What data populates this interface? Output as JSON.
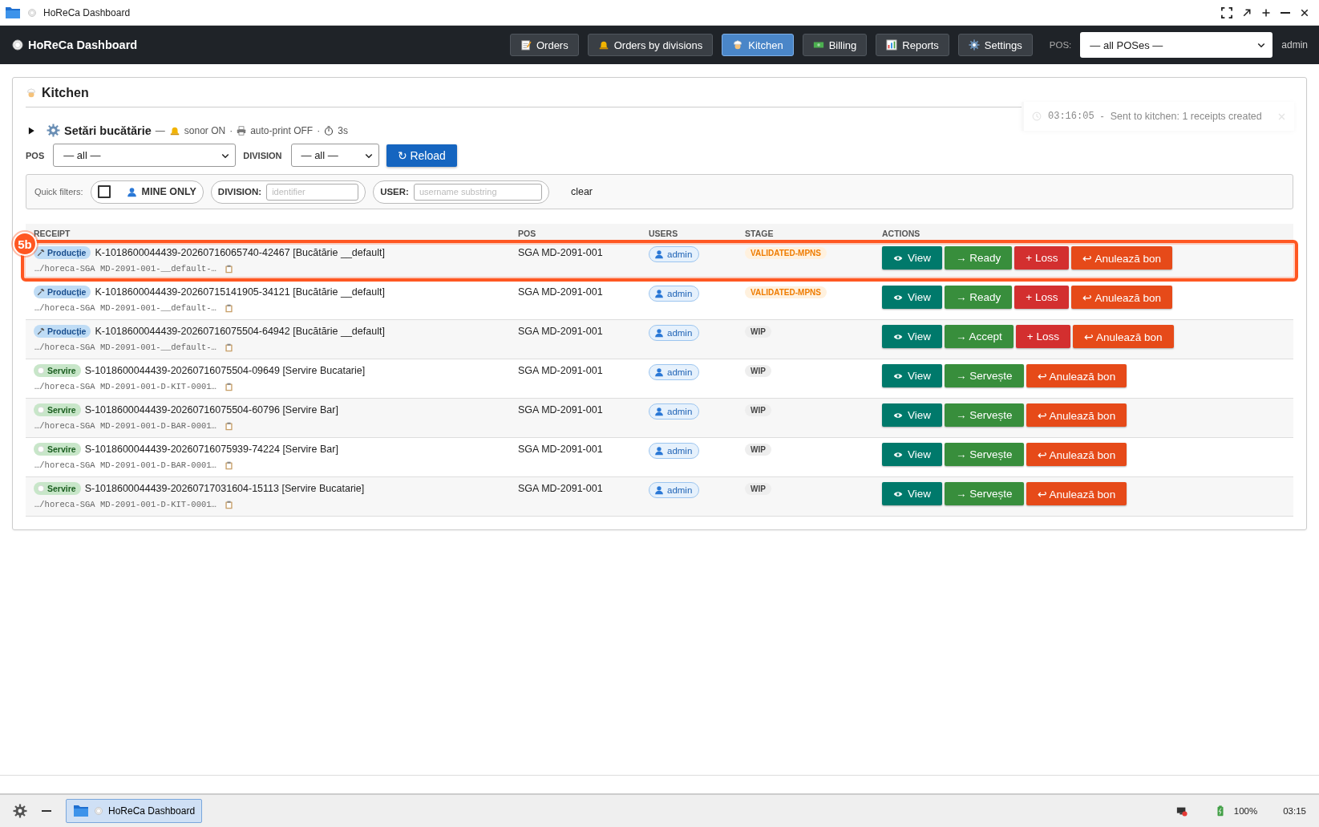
{
  "window": {
    "title": "HoReCa Dashboard"
  },
  "navbar": {
    "brand": "HoReCa Dashboard",
    "items": [
      {
        "label": "Orders",
        "selected": false
      },
      {
        "label": "Orders by divisions",
        "selected": false
      },
      {
        "label": "Kitchen",
        "selected": true
      },
      {
        "label": "Billing",
        "selected": false
      },
      {
        "label": "Reports",
        "selected": false
      },
      {
        "label": "Settings",
        "selected": false
      }
    ],
    "pos_label": "POS:",
    "pos_value": "— all POSes —",
    "user": "admin"
  },
  "page": {
    "title": "Kitchen"
  },
  "toast": {
    "time": "03:16:05",
    "separator": "-",
    "message": "Sent to kitchen: 1 receipts created"
  },
  "settings": {
    "title": "Setări bucătărie",
    "dash": "—",
    "items": [
      "sonor ON",
      "auto-print OFF",
      "3s"
    ],
    "separator": "·"
  },
  "filters": {
    "pos_label": "POS",
    "pos_value": "— all —",
    "division_label": "DIVISION",
    "division_value": "— all —",
    "reload": "↻ Reload"
  },
  "quick_filters": {
    "label": "Quick filters:",
    "mine_only": {
      "label": "MINE ONLY",
      "checked": false
    },
    "division": {
      "label": "DIVISION:",
      "placeholder": "identifier"
    },
    "user": {
      "label": "USER:",
      "placeholder": "username substring"
    },
    "clear": "clear"
  },
  "table": {
    "columns": [
      "RECEIPT",
      "POS",
      "USERS",
      "STAGE",
      "ACTIONS"
    ],
    "rows": [
      {
        "callout": "5b",
        "badge": {
          "kind": "production",
          "label": "Producție"
        },
        "receipt": "K-1018600044439-20260716065740-42467 [Bucătărie __default]",
        "path": "…/horeca-SGA MD-2091-001-__default-…",
        "pos": "SGA MD-2091-001",
        "user": "admin",
        "stage": {
          "kind": "validated",
          "label": "VALIDATED-MPNS"
        },
        "actions": [
          {
            "kind": "view",
            "label": "View"
          },
          {
            "kind": "advance",
            "label": "→ Ready"
          },
          {
            "kind": "loss",
            "label": "+ Loss"
          },
          {
            "kind": "cancel",
            "label": "↩ Anulează bon"
          }
        ]
      },
      {
        "badge": {
          "kind": "production",
          "label": "Producție"
        },
        "receipt": "K-1018600044439-20260715141905-34121 [Bucătărie __default]",
        "path": "…/horeca-SGA MD-2091-001-__default-…",
        "pos": "SGA MD-2091-001",
        "user": "admin",
        "stage": {
          "kind": "validated",
          "label": "VALIDATED-MPNS"
        },
        "actions": [
          {
            "kind": "view",
            "label": "View"
          },
          {
            "kind": "advance",
            "label": "→ Ready"
          },
          {
            "kind": "loss",
            "label": "+ Loss"
          },
          {
            "kind": "cancel",
            "label": "↩ Anulează bon"
          }
        ]
      },
      {
        "badge": {
          "kind": "production",
          "label": "Producție"
        },
        "receipt": "K-1018600044439-20260716075504-64942 [Bucătărie __default]",
        "path": "…/horeca-SGA MD-2091-001-__default-…",
        "pos": "SGA MD-2091-001",
        "user": "admin",
        "stage": {
          "kind": "wip",
          "label": "WIP"
        },
        "actions": [
          {
            "kind": "view",
            "label": "View"
          },
          {
            "kind": "advance",
            "label": "→ Accept"
          },
          {
            "kind": "loss",
            "label": "+ Loss"
          },
          {
            "kind": "cancel",
            "label": "↩ Anulează bon"
          }
        ]
      },
      {
        "badge": {
          "kind": "serving",
          "label": "Servire"
        },
        "receipt": "S-1018600044439-20260716075504-09649 [Servire Bucatarie]",
        "path": "…/horeca-SGA MD-2091-001-D-KIT-0001…",
        "pos": "SGA MD-2091-001",
        "user": "admin",
        "stage": {
          "kind": "wip",
          "label": "WIP"
        },
        "actions": [
          {
            "kind": "view",
            "label": "View"
          },
          {
            "kind": "advance",
            "label": "→ Servește"
          },
          {
            "kind": "cancel",
            "label": "↩ Anulează bon"
          }
        ]
      },
      {
        "badge": {
          "kind": "serving",
          "label": "Servire"
        },
        "receipt": "S-1018600044439-20260716075504-60796 [Servire Bar]",
        "path": "…/horeca-SGA MD-2091-001-D-BAR-0001…",
        "pos": "SGA MD-2091-001",
        "user": "admin",
        "stage": {
          "kind": "wip",
          "label": "WIP"
        },
        "actions": [
          {
            "kind": "view",
            "label": "View"
          },
          {
            "kind": "advance",
            "label": "→ Servește"
          },
          {
            "kind": "cancel",
            "label": "↩ Anulează bon"
          }
        ]
      },
      {
        "badge": {
          "kind": "serving",
          "label": "Servire"
        },
        "receipt": "S-1018600044439-20260716075939-74224 [Servire Bar]",
        "path": "…/horeca-SGA MD-2091-001-D-BAR-0001…",
        "pos": "SGA MD-2091-001",
        "user": "admin",
        "stage": {
          "kind": "wip",
          "label": "WIP"
        },
        "actions": [
          {
            "kind": "view",
            "label": "View"
          },
          {
            "kind": "advance",
            "label": "→ Servește"
          },
          {
            "kind": "cancel",
            "label": "↩ Anulează bon"
          }
        ]
      },
      {
        "badge": {
          "kind": "serving",
          "label": "Servire"
        },
        "receipt": "S-1018600044439-20260717031604-15113 [Servire Bucatarie]",
        "path": "…/horeca-SGA MD-2091-001-D-KIT-0001…",
        "pos": "SGA MD-2091-001",
        "user": "admin",
        "stage": {
          "kind": "wip",
          "label": "WIP"
        },
        "actions": [
          {
            "kind": "view",
            "label": "View"
          },
          {
            "kind": "advance",
            "label": "→ Servește"
          },
          {
            "kind": "cancel",
            "label": "↩ Anulează bon"
          }
        ]
      }
    ]
  },
  "taskbar": {
    "task": {
      "label": "HoReCa Dashboard",
      "selected": true
    },
    "battery": "100%",
    "clock": "03:15"
  }
}
